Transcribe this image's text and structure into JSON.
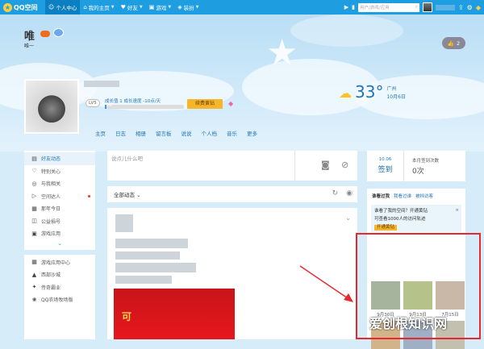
{
  "topbar": {
    "logo_text": "QQ空间",
    "nav": [
      {
        "label": "个人中心",
        "icon": "person-icon",
        "active": true
      },
      {
        "label": "我的主页",
        "icon": "home-icon",
        "active": false
      },
      {
        "label": "好友",
        "icon": "friends-icon",
        "active": false
      },
      {
        "label": "游戏",
        "icon": "game-icon",
        "active": false
      },
      {
        "label": "装扮",
        "icon": "shirt-icon",
        "active": false
      }
    ],
    "search_placeholder": "用户/游戏/应用"
  },
  "profile": {
    "name": "唯",
    "subtitle": "唯一",
    "level": "LV5",
    "growth_label": "成长值 1",
    "growth_speed": "成长速度 -10点/天",
    "growth_percent": 0,
    "growth_percent_text": "0%",
    "vip_button": "续费黄钻",
    "likes": "2"
  },
  "weather": {
    "temp": "33°",
    "city": "广州",
    "date": "10月6日"
  },
  "tabs": [
    "主页",
    "日志",
    "相册",
    "留言板",
    "说说",
    "个人档",
    "音乐",
    "更多"
  ],
  "left_menu": {
    "group1": [
      {
        "label": "好友动态",
        "icon": "feed-icon",
        "active": true
      },
      {
        "label": "特别关心",
        "icon": "heart-icon"
      },
      {
        "label": "与我相关",
        "icon": "bell-icon"
      },
      {
        "label": "空间达人",
        "icon": "play-icon",
        "dot": true
      },
      {
        "label": "那年今日",
        "icon": "calendar-icon"
      },
      {
        "label": "公益捐号",
        "icon": "gift-icon"
      },
      {
        "label": "游戏应用",
        "icon": "app-icon"
      }
    ],
    "group2": [
      {
        "label": "游戏应用中心",
        "icon": "grid-icon"
      },
      {
        "label": "西部沙城",
        "icon": "castle-icon"
      },
      {
        "label": "传奇霸业",
        "icon": "sword-icon"
      },
      {
        "label": "QQ农场牧场版",
        "icon": "farm-icon"
      }
    ]
  },
  "post": {
    "placeholder": "说点儿什么吧"
  },
  "feed": {
    "filter": "全部动态",
    "banner_text": "可"
  },
  "sign": {
    "date": "10.06",
    "button": "签到",
    "label": "本月签到次数",
    "count": "0次"
  },
  "trace": {
    "tabs": [
      "谁看过我",
      "我看过谁",
      "被挡访客"
    ],
    "tip_line1": "谁看了我的空间？开通黄钻",
    "tip_line2": "可查看1000人的访问轨迹",
    "tip_button": "开通黄钻",
    "dates": [
      "9月30日",
      "9月13日",
      "7月15日"
    ]
  },
  "watermark": "爱创根知识网"
}
